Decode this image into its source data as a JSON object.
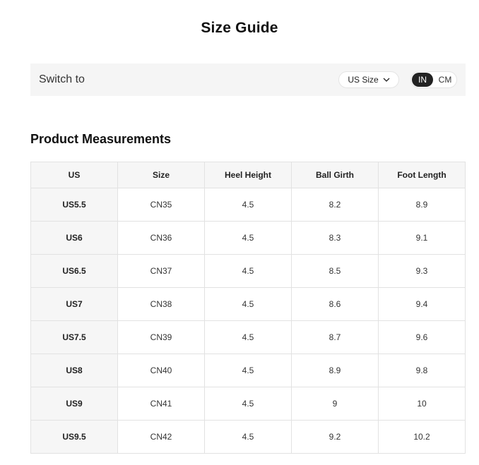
{
  "title": "Size Guide",
  "switch": {
    "label": "Switch to",
    "size_select_value": "US Size",
    "units": [
      "IN",
      "CM"
    ],
    "active_unit": "IN"
  },
  "section_title": "Product Measurements",
  "table": {
    "headers": [
      "US",
      "Size",
      "Heel Height",
      "Ball Girth",
      "Foot Length"
    ],
    "rows": [
      [
        "US5.5",
        "CN35",
        "4.5",
        "8.2",
        "8.9"
      ],
      [
        "US6",
        "CN36",
        "4.5",
        "8.3",
        "9.1"
      ],
      [
        "US6.5",
        "CN37",
        "4.5",
        "8.5",
        "9.3"
      ],
      [
        "US7",
        "CN38",
        "4.5",
        "8.6",
        "9.4"
      ],
      [
        "US7.5",
        "CN39",
        "4.5",
        "8.7",
        "9.6"
      ],
      [
        "US8",
        "CN40",
        "4.5",
        "8.9",
        "9.8"
      ],
      [
        "US9",
        "CN41",
        "4.5",
        "9",
        "10"
      ],
      [
        "US9.5",
        "CN42",
        "4.5",
        "9.2",
        "10.2"
      ]
    ]
  }
}
